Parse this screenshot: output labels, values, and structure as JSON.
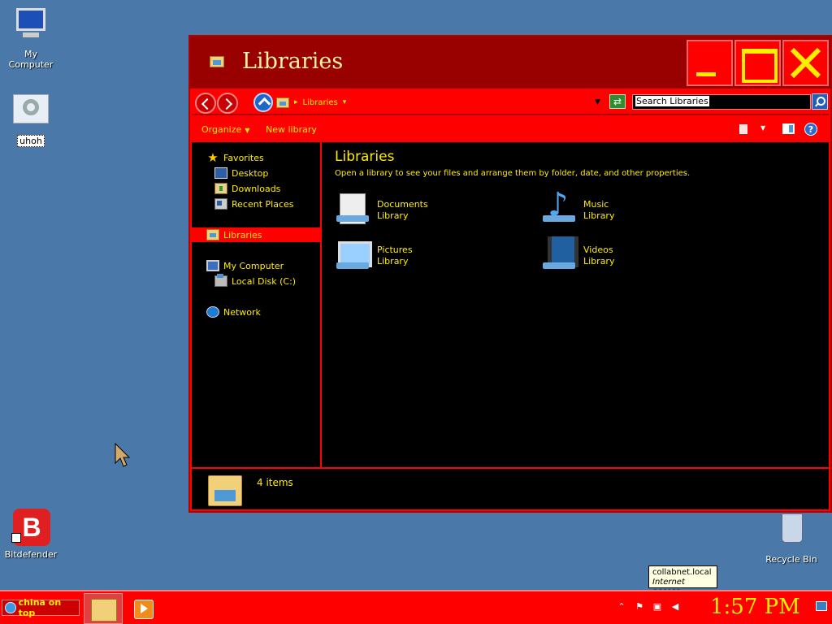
{
  "desktop": {
    "icons": [
      {
        "label": "My Computer"
      },
      {
        "label": "uhoh"
      },
      {
        "label": "Bitdefender"
      },
      {
        "label": "Recycle Bin"
      }
    ]
  },
  "window": {
    "title": "Libraries",
    "address": {
      "path": [
        "Libraries"
      ],
      "search_placeholder": "Search Libraries"
    },
    "commands": {
      "organize": "Organize",
      "new_library": "New library"
    },
    "nav": {
      "favorites": "Favorites",
      "desktop": "Desktop",
      "downloads": "Downloads",
      "recent": "Recent Places",
      "libraries": "Libraries",
      "computer": "My Computer",
      "local_disk": "Local Disk (C:)",
      "network": "Network"
    },
    "content": {
      "title": "Libraries",
      "description": "Open a library to see your files and arrange them by folder, date, and other properties.",
      "libraries": [
        {
          "name": "Documents",
          "type": "Library",
          "icon": "documents-library-icon"
        },
        {
          "name": "Music",
          "type": "Library",
          "icon": "music-library-icon"
        },
        {
          "name": "Pictures",
          "type": "Library",
          "icon": "pictures-library-icon"
        },
        {
          "name": "Videos",
          "type": "Library",
          "icon": "videos-library-icon"
        }
      ]
    },
    "details": {
      "count": "4 items"
    }
  },
  "tooltip": {
    "line1": "collabnet.local",
    "line2": "Internet access"
  },
  "taskbar": {
    "start_label": "china on top",
    "clock": "1:57 PM"
  },
  "colors": {
    "desktop": "#4a78a8",
    "accent": "#ff0000",
    "text": "#ffee00"
  }
}
